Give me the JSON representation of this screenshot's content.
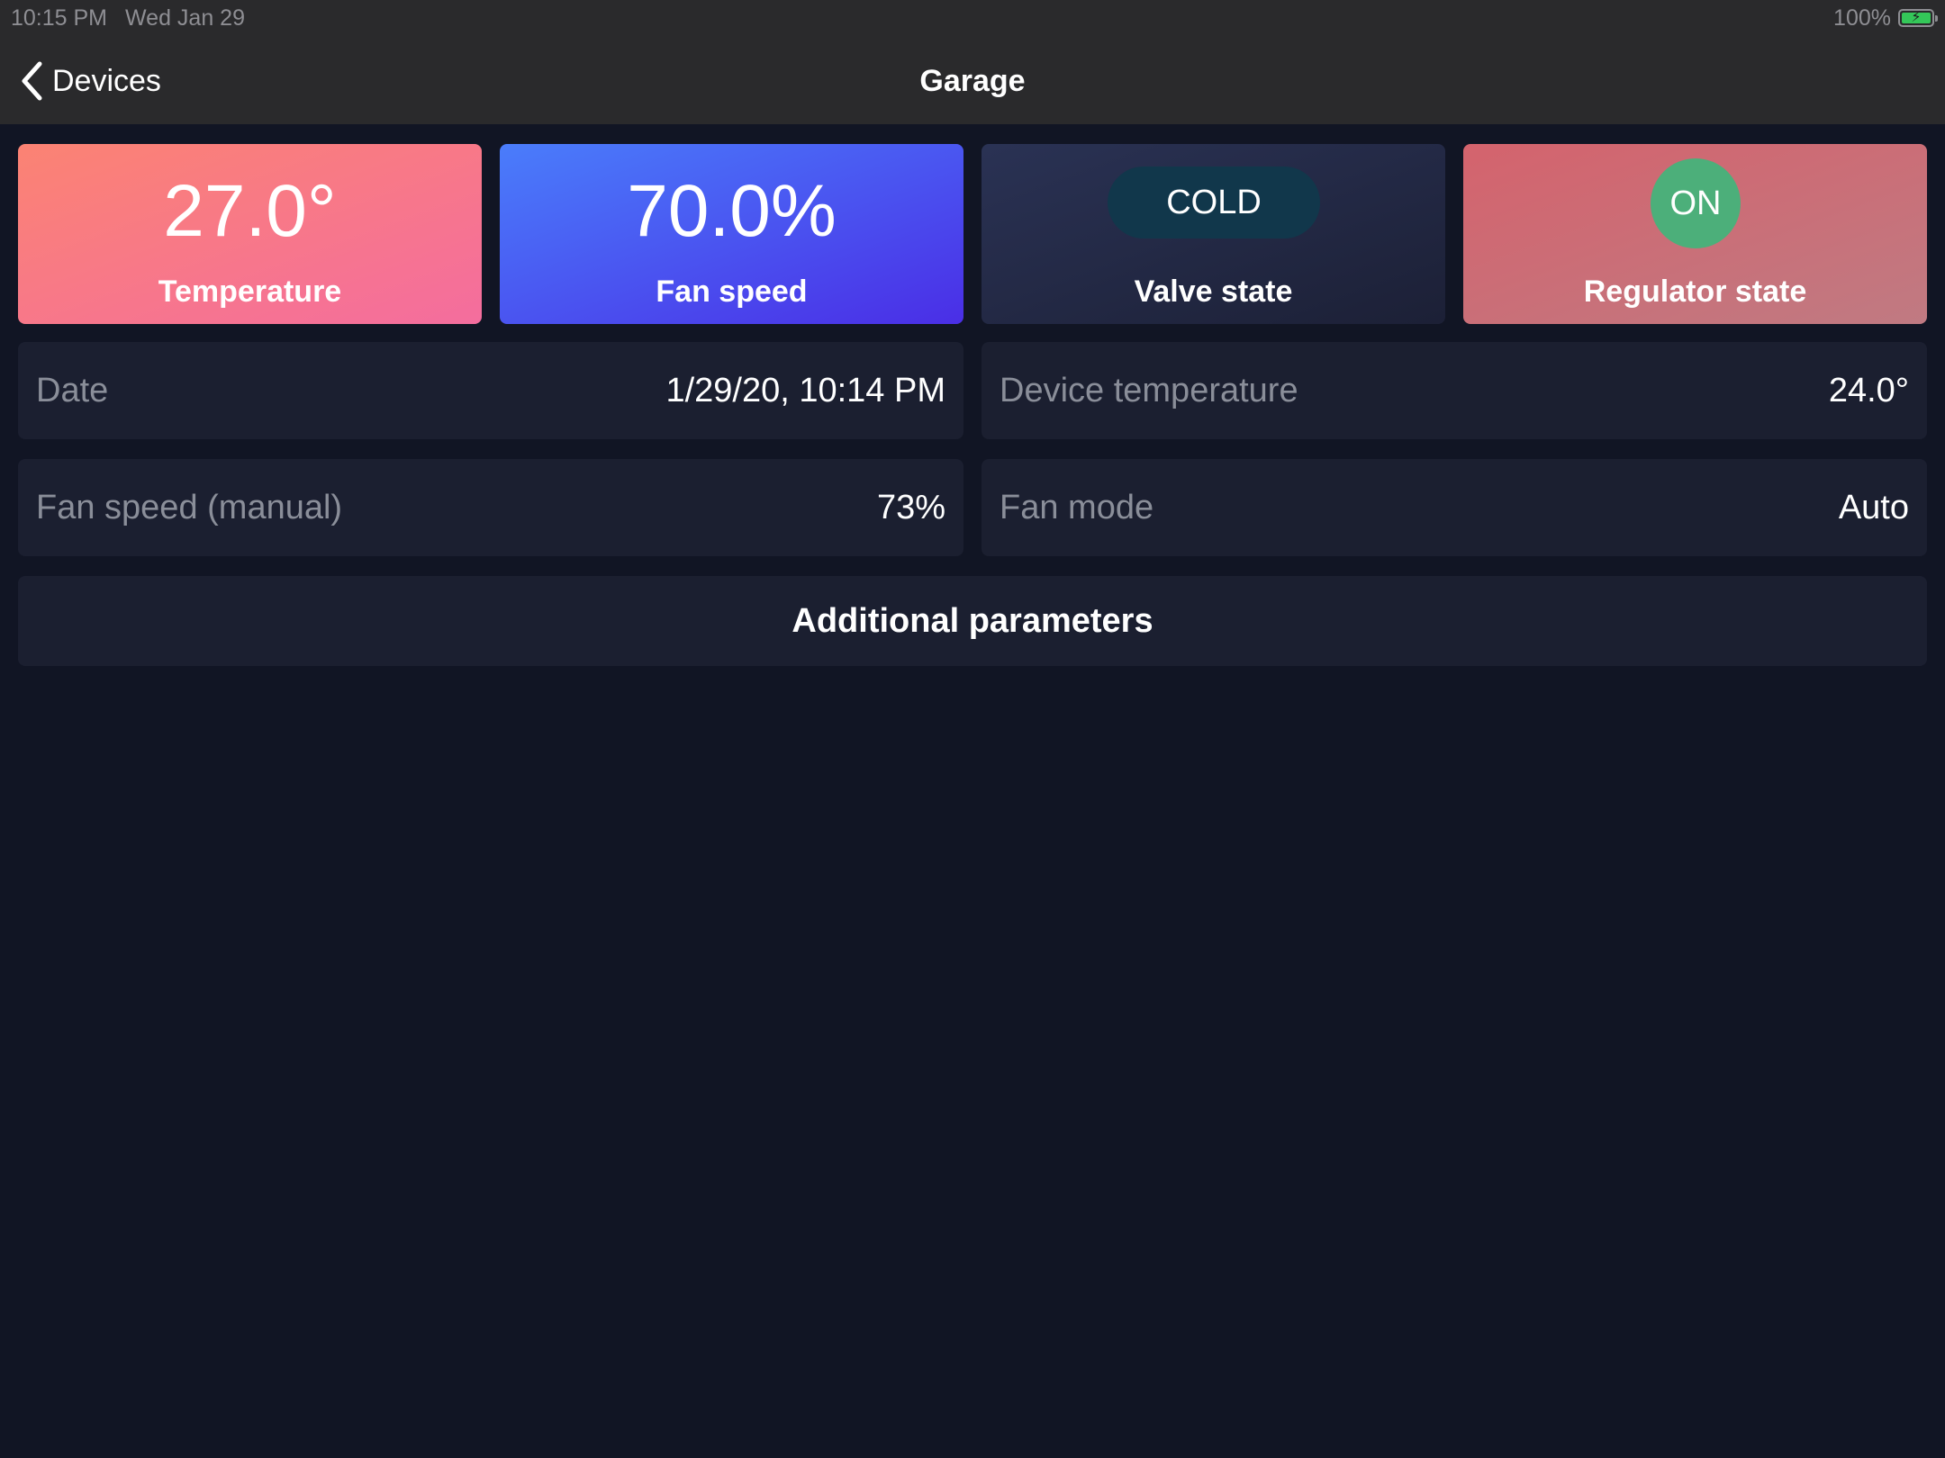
{
  "status_bar": {
    "time": "10:15 PM",
    "date": "Wed Jan 29",
    "battery_percent_label": "100%",
    "battery_level": 1.0,
    "battery_icon": "battery-charging-icon",
    "battery_color": "#34c759"
  },
  "nav": {
    "back_label": "Devices",
    "back_icon": "chevron-left-icon",
    "title": "Garage"
  },
  "tiles": {
    "temperature": {
      "value": "27.0°",
      "label": "Temperature"
    },
    "fan_speed": {
      "value": "70.0%",
      "label": "Fan speed"
    },
    "valve_state": {
      "value": "COLD",
      "label": "Valve state"
    },
    "regulator_state": {
      "value": "ON",
      "label": "Regulator state"
    }
  },
  "info": {
    "date": {
      "label": "Date",
      "value": "1/29/20, 10:14 PM"
    },
    "device_temperature": {
      "label": "Device temperature",
      "value": "24.0°"
    },
    "fan_speed_manual": {
      "label": "Fan speed (manual)",
      "value": "73%"
    },
    "fan_mode": {
      "label": "Fan mode",
      "value": "Auto"
    }
  },
  "additional_parameters": {
    "label": "Additional parameters"
  },
  "colors": {
    "background": "#111524",
    "card": "#1b1f30",
    "topbar": "#2a2a2c",
    "temperature_gradient": [
      "#fb8373",
      "#f46d9e"
    ],
    "fan_gradient": [
      "#4a7dfb",
      "#4a2ee6"
    ],
    "valve_gradient": [
      "#2a3254",
      "#1c2036"
    ],
    "regulator_gradient": [
      "#d4636d",
      "#c07a82"
    ],
    "cold_pill": "#11374b",
    "on_pill": "#4caf7a"
  }
}
